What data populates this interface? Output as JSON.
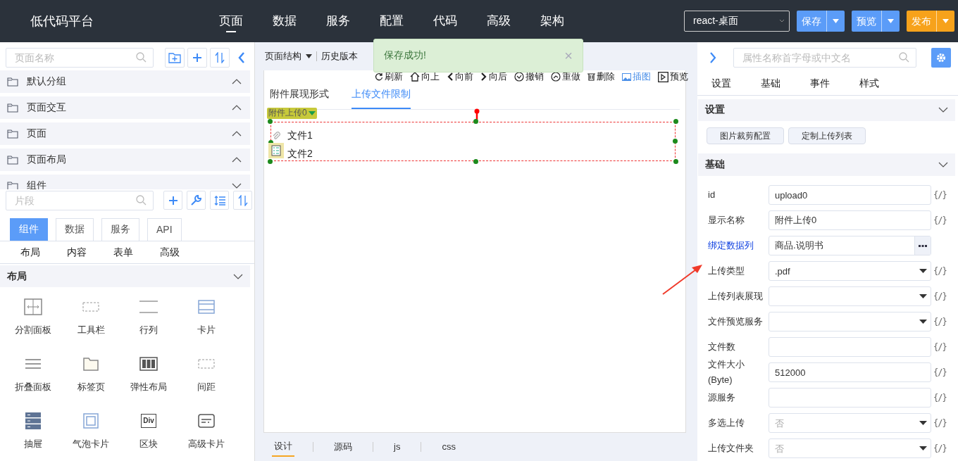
{
  "header": {
    "logo": "低代码平台",
    "nav": [
      {
        "label": "页面",
        "selected": true
      },
      {
        "label": "数据",
        "selected": false
      },
      {
        "label": "服务",
        "selected": false
      },
      {
        "label": "配置",
        "selected": false
      },
      {
        "label": "代码",
        "selected": false
      },
      {
        "label": "高级",
        "selected": false
      },
      {
        "label": "架构",
        "selected": false
      }
    ],
    "platform_select": {
      "value": "react-桌面"
    },
    "actions": [
      {
        "label": "保存",
        "color": "#5b9cf8"
      },
      {
        "label": "预览",
        "color": "#5b9cf8"
      },
      {
        "label": "发布",
        "color": "#f7a21b"
      }
    ]
  },
  "left": {
    "page_search": {
      "placeholder": "页面名称"
    },
    "groups": [
      {
        "label": "默认分组",
        "expanded": false
      },
      {
        "label": "页面交互",
        "expanded": false
      },
      {
        "label": "页面",
        "expanded": false
      },
      {
        "label": "页面布局",
        "expanded": false
      },
      {
        "label": "组件",
        "expanded": true
      }
    ],
    "fragment_search": {
      "placeholder": "片段"
    },
    "tabs": [
      {
        "label": "组件",
        "selected": true
      },
      {
        "label": "数据",
        "selected": false
      },
      {
        "label": "服务",
        "selected": false
      },
      {
        "label": "API",
        "selected": false
      }
    ],
    "categories": [
      "布局",
      "内容",
      "表单",
      "高级"
    ],
    "section": {
      "title": "布局",
      "expanded": true
    },
    "components": [
      {
        "label": "分割面板",
        "kind": "split"
      },
      {
        "label": "工具栏",
        "kind": "toolbar"
      },
      {
        "label": "行列",
        "kind": "row"
      },
      {
        "label": "卡片",
        "kind": "card"
      },
      {
        "label": "折叠面板",
        "kind": "collapse"
      },
      {
        "label": "标签页",
        "kind": "tabs"
      },
      {
        "label": "弹性布局",
        "kind": "flex"
      },
      {
        "label": "间距",
        "kind": "spacer"
      },
      {
        "label": "抽屉",
        "kind": "drawer"
      },
      {
        "label": "气泡卡片",
        "kind": "popover"
      },
      {
        "label": "区块",
        "kind": "div",
        "icon_text": "Div"
      },
      {
        "label": "高级卡片",
        "kind": "advcard"
      }
    ]
  },
  "center": {
    "toolbar": [
      {
        "label": "页面结构",
        "dropdown": true
      },
      {
        "label": "历史版本",
        "dropdown": false
      }
    ],
    "toast": {
      "message": "保存成功!",
      "close": "×"
    },
    "actions": [
      {
        "label": "刷新",
        "kind": "refresh",
        "active": false
      },
      {
        "label": "向上",
        "kind": "up",
        "active": false
      },
      {
        "label": "向前",
        "kind": "back",
        "active": false
      },
      {
        "label": "向后",
        "kind": "forward",
        "active": false
      },
      {
        "label": "撤销",
        "kind": "undo",
        "active": false
      },
      {
        "label": "重做",
        "kind": "redo",
        "active": false
      },
      {
        "label": "删除",
        "kind": "delete",
        "active": false
      },
      {
        "label": "插图",
        "kind": "image",
        "active": true
      },
      {
        "label": "预览",
        "kind": "preview",
        "active": false
      }
    ],
    "canvas_tabs": [
      {
        "label": "附件展现形式",
        "selected": false
      },
      {
        "label": "上传文件限制",
        "selected": true
      }
    ],
    "upload": {
      "label": "附件上传0",
      "selected": true,
      "files": [
        "文件1",
        "文件2"
      ]
    },
    "bottom_tabs": [
      {
        "label": "设计",
        "selected": true
      },
      {
        "label": "源码",
        "selected": false
      },
      {
        "label": "js",
        "selected": false
      },
      {
        "label": "css",
        "selected": false
      }
    ]
  },
  "right": {
    "search": {
      "placeholder": "属性名称首字母或中文名"
    },
    "tabs": [
      "设置",
      "基础",
      "事件",
      "样式"
    ],
    "settings": {
      "title": "设置",
      "expanded": true,
      "buttons": [
        "图片裁剪配置",
        "定制上传列表"
      ]
    },
    "basic": {
      "title": "基础",
      "expanded": true,
      "fields": [
        {
          "label": "id",
          "kind": "text",
          "value": "upload0",
          "bind": "{/}",
          "link": false
        },
        {
          "label": "显示名称",
          "kind": "text",
          "value": "附件上传0",
          "bind": "{/}",
          "link": false
        },
        {
          "label": "绑定数据列",
          "kind": "lookup",
          "value": "商品.说明书",
          "link": true
        },
        {
          "label": "上传类型",
          "kind": "select",
          "value": ".pdf",
          "bind": "{/}",
          "link": false
        },
        {
          "label": "上传列表展现",
          "kind": "select",
          "bind": "{/}",
          "link": false
        },
        {
          "label": "文件预览服务",
          "kind": "select",
          "bind": "{/}",
          "link": false
        },
        {
          "label": "文件数",
          "kind": "text",
          "bind": "{/}",
          "link": false
        },
        {
          "label": "文件大小(Byte)",
          "kind": "text",
          "value": "512000",
          "bind": "{/}",
          "link": false
        },
        {
          "label": "源服务",
          "kind": "text",
          "bind": "{/}",
          "link": false
        },
        {
          "label": "多选上传",
          "kind": "select",
          "placeholder": "否",
          "bind": "{/}",
          "link": false
        },
        {
          "label": "上传文件夹",
          "kind": "select",
          "placeholder": "否",
          "bind": "{/}",
          "link": false
        }
      ]
    }
  }
}
